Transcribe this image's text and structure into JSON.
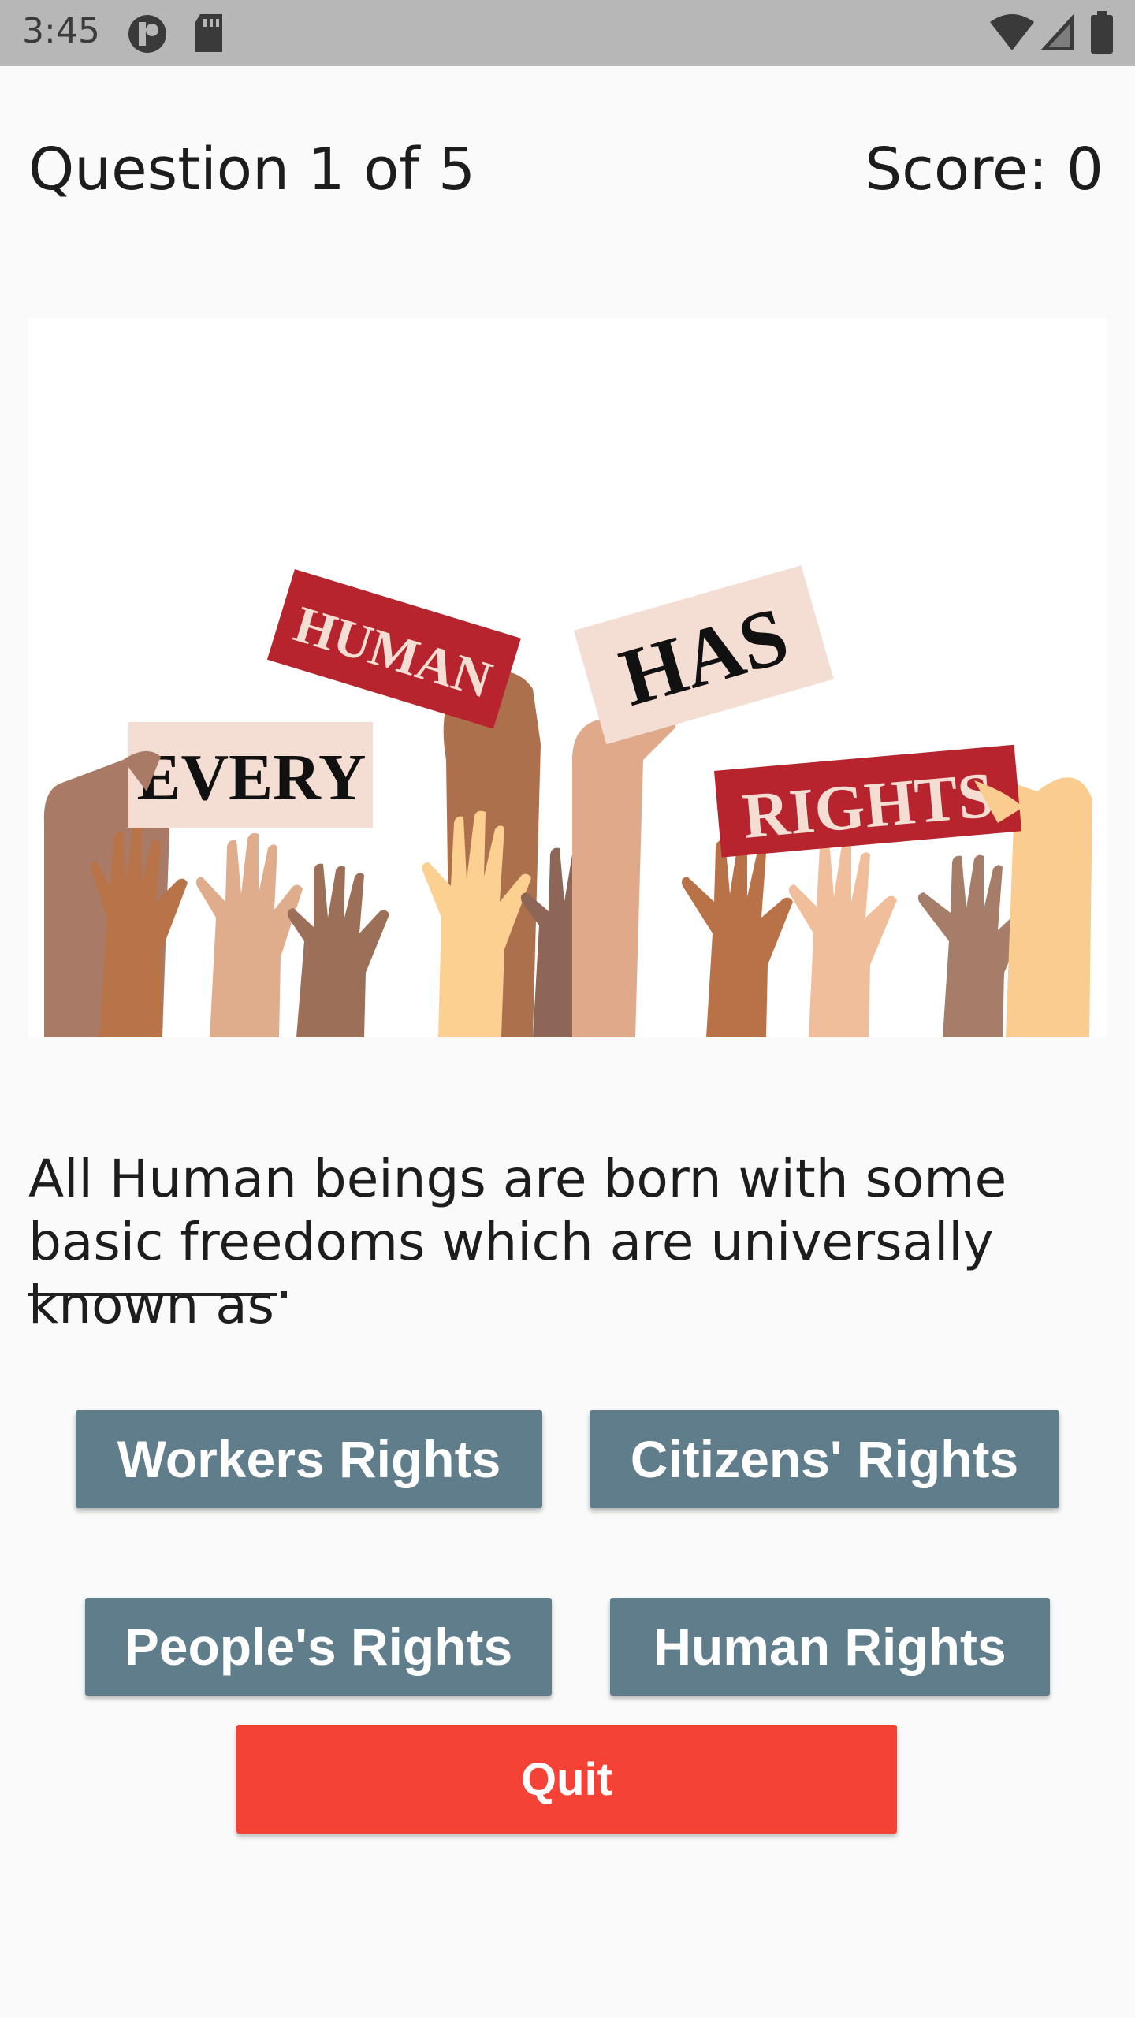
{
  "status_bar": {
    "time": "3:45",
    "icons": [
      "notification-dot-icon",
      "sd-card-icon",
      "wifi-icon",
      "signal-icon",
      "battery-icon"
    ]
  },
  "header": {
    "question_counter": "Question 1 of 5",
    "score": "Score: 0"
  },
  "image": {
    "signs": [
      "HUMAN",
      "HAS",
      "EVERY",
      "RIGHTS"
    ]
  },
  "question": {
    "text": "All Human beings are born with some basic freedoms which are universally known as"
  },
  "answers": [
    {
      "label": "Workers Rights"
    },
    {
      "label": "Citizens' Rights"
    },
    {
      "label": "People's Rights"
    },
    {
      "label": "Human Rights"
    }
  ],
  "quit": {
    "label": "Quit"
  },
  "colors": {
    "answer_button": "#607d8b",
    "quit_button": "#f44336",
    "status_bar": "#b7b7b7",
    "sign_red": "#b8242e",
    "sign_cream": "#f4ddd2"
  }
}
